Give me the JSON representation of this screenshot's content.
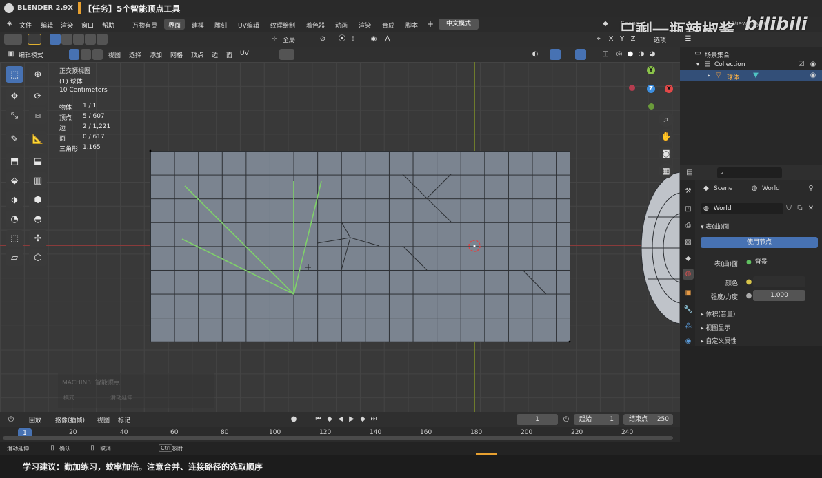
{
  "titlebar": {
    "app": "BLENDER 2.9X",
    "task": "【任务】5个智能顶点工具"
  },
  "menu": [
    "文件",
    "编辑",
    "渲染",
    "窗口",
    "帮助"
  ],
  "workspaces": [
    "万物有灵",
    "界面",
    "建模",
    "雕刻",
    "UV编辑",
    "纹理绘制",
    "着色器",
    "动画",
    "渲染",
    "合成",
    "脚本"
  ],
  "active_workspace": "界面",
  "chinese_mode": "中文模式",
  "scene_label": "Scene",
  "viewlayer_label": "View Layer",
  "watermark": "只剩一瓶辣椒酱",
  "watermark_logo": "bilibili",
  "header1": {
    "transform_orientation": "全局",
    "options": "选项"
  },
  "header2": {
    "mode": "编辑模式",
    "menus": [
      "视图",
      "选择",
      "添加",
      "网格",
      "顶点",
      "边",
      "面",
      "UV"
    ]
  },
  "viewport": {
    "view_name": "正交顶视图",
    "object_name": "(1) 球体",
    "scale": "10 Centimeters",
    "stats": [
      {
        "label": "物体",
        "value": "1 / 1"
      },
      {
        "label": "顶点",
        "value": "5 / 607"
      },
      {
        "label": "边",
        "value": "2 / 1,221"
      },
      {
        "label": "面",
        "value": "0 / 617"
      },
      {
        "label": "三角形",
        "value": "1,165"
      }
    ],
    "operator_panel_title": "MACHIN3: 智能顶点",
    "operator_fields": [
      "模式",
      "滑动延伸"
    ]
  },
  "gizmo": {
    "y": "Y",
    "z": "Z",
    "x": "X"
  },
  "outliner": {
    "root": "场景集合",
    "collection": "Collection",
    "object": "球体"
  },
  "properties": {
    "scene": "Scene",
    "world": "World",
    "world_name": "World",
    "panel_surface": "表(曲)面",
    "use_nodes": "使用节点",
    "surface_label": "表(曲)面",
    "surface_value": "背景",
    "color_label": "颜色",
    "strength_label": "强度/力度",
    "strength_value": "1.000",
    "volume": "体积(音量)",
    "viewport_display": "视图显示",
    "custom_props": "自定义属性"
  },
  "timeline": {
    "menus": [
      "回放",
      "抠像(插帧)",
      "视图",
      "标记"
    ],
    "current_frame": "1",
    "start_label": "起始",
    "start_value": "1",
    "end_label": "结束点",
    "end_value": "250",
    "ticks": [
      "1",
      "20",
      "40",
      "60",
      "80",
      "100",
      "120",
      "140",
      "160",
      "180",
      "200",
      "220",
      "240"
    ]
  },
  "statusbar": {
    "left": "滑动延伸",
    "confirm": "确认",
    "cancel": "取消",
    "ctrl": "Ctrl",
    "snap": "吸附"
  },
  "tip": "学习建议：勤加练习，效率加倍。注意合并、连接路径的选取顺序",
  "colors": {
    "accent": "#4772b3",
    "selection_green": "#7fd06a",
    "title_orange": "#e7a030"
  }
}
